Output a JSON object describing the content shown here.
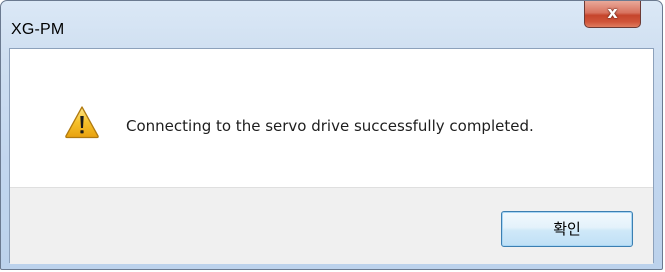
{
  "window": {
    "title": "XG-PM",
    "close_glyph": "x"
  },
  "dialog": {
    "icon": "warning-icon",
    "message": "Connecting to the servo drive successfully completed.",
    "ok_label": "확인"
  },
  "colors": {
    "close_button": "#c5452c",
    "ok_button_border": "#3c7fb1",
    "warning_fill": "#f6c12b"
  }
}
